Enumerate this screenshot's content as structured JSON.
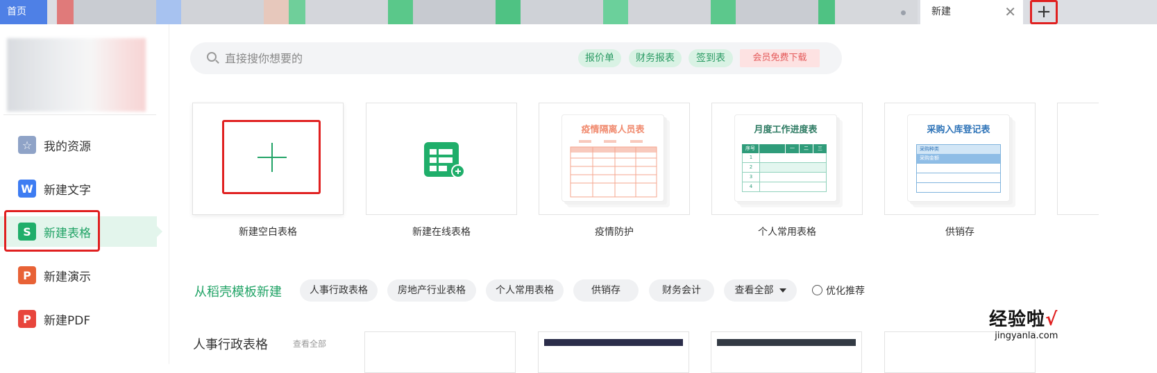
{
  "tabs": {
    "home_label": "首页",
    "new_label": "新建",
    "close_glyph": "✕",
    "plus_glyph": "+"
  },
  "sidebar": {
    "items": [
      {
        "label": "我的资源",
        "icon": "star-icon",
        "glyph": "☆"
      },
      {
        "label": "新建文字",
        "icon": "writer-icon",
        "glyph": "W"
      },
      {
        "label": "新建表格",
        "icon": "spreadsheet-icon",
        "glyph": "S"
      },
      {
        "label": "新建演示",
        "icon": "presentation-icon",
        "glyph": "P"
      },
      {
        "label": "新建PDF",
        "icon": "pdf-icon",
        "glyph": "P"
      }
    ],
    "active_index": 2
  },
  "search": {
    "placeholder": "直接搜你想要的",
    "chips": [
      "报价单",
      "财务报表",
      "签到表"
    ],
    "vip_label": "会员免费下载"
  },
  "cards": [
    {
      "label": "新建空白表格"
    },
    {
      "label": "新建在线表格"
    },
    {
      "label": "疫情防护",
      "thumb_title": "疫情隔离人员表",
      "accent": "#f08a6e"
    },
    {
      "label": "个人常用表格",
      "thumb_title": "月度工作进度表",
      "accent": "#2f9c7a",
      "header_cells": [
        "序号",
        "",
        "一",
        "二",
        "三"
      ],
      "row_nums": [
        "1",
        "2",
        "3",
        "4"
      ]
    },
    {
      "label": "供销存",
      "thumb_title": "采购入库登记表",
      "accent": "#3d8cc9",
      "rows": [
        "采购种类",
        "采购金额"
      ]
    }
  ],
  "templates": {
    "title": "从稻壳模板新建",
    "categories": [
      "人事行政表格",
      "房地产行业表格",
      "个人常用表格",
      "供销存",
      "财务会计",
      "查看全部"
    ],
    "optimize_label": "优化推荐"
  },
  "bottom": {
    "title": "人事行政表格",
    "link": "查看全部"
  },
  "watermark": {
    "line1": "经验啦",
    "check": "√",
    "line2": "jingyanla.com"
  },
  "colors": {
    "accent_green": "#21a366",
    "highlight_red": "#e02020",
    "tab_blue": "#4e80e6"
  }
}
